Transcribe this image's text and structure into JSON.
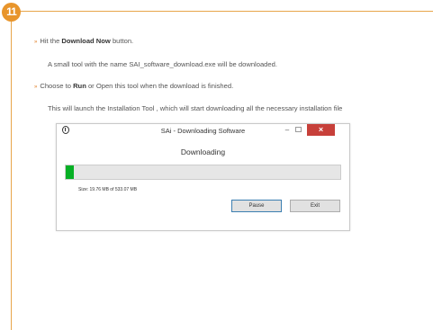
{
  "step": {
    "number": "11"
  },
  "instructions": [
    {
      "prefix": "Hit the ",
      "bold": "Download Now",
      "suffix": " button.",
      "bullet": true
    },
    {
      "prefix": "A small tool with the name SAI_software_download.exe will be downloaded.",
      "bold": "",
      "suffix": "",
      "bullet": false
    },
    {
      "prefix": "Choose to ",
      "bold": "Run",
      "suffix": " or Open this tool when the download is finished.",
      "bullet": true
    },
    {
      "prefix": "This will launch the Installation Tool , which will start downloading all the necessary installation file",
      "bold": "",
      "suffix": "",
      "bullet": false
    }
  ],
  "dialog": {
    "title": "SAi - Downloading Software",
    "status": "Downloading",
    "progress": 0.028,
    "size_text": "Size: 19.76 MB of 533.07 MB",
    "pause_label": "Pause",
    "exit_label": "Exit",
    "minimize_glyph": "–",
    "close_glyph": "×"
  },
  "colors": {
    "accent": "#e8952c",
    "progress": "#06b025",
    "close": "#c7403a"
  }
}
